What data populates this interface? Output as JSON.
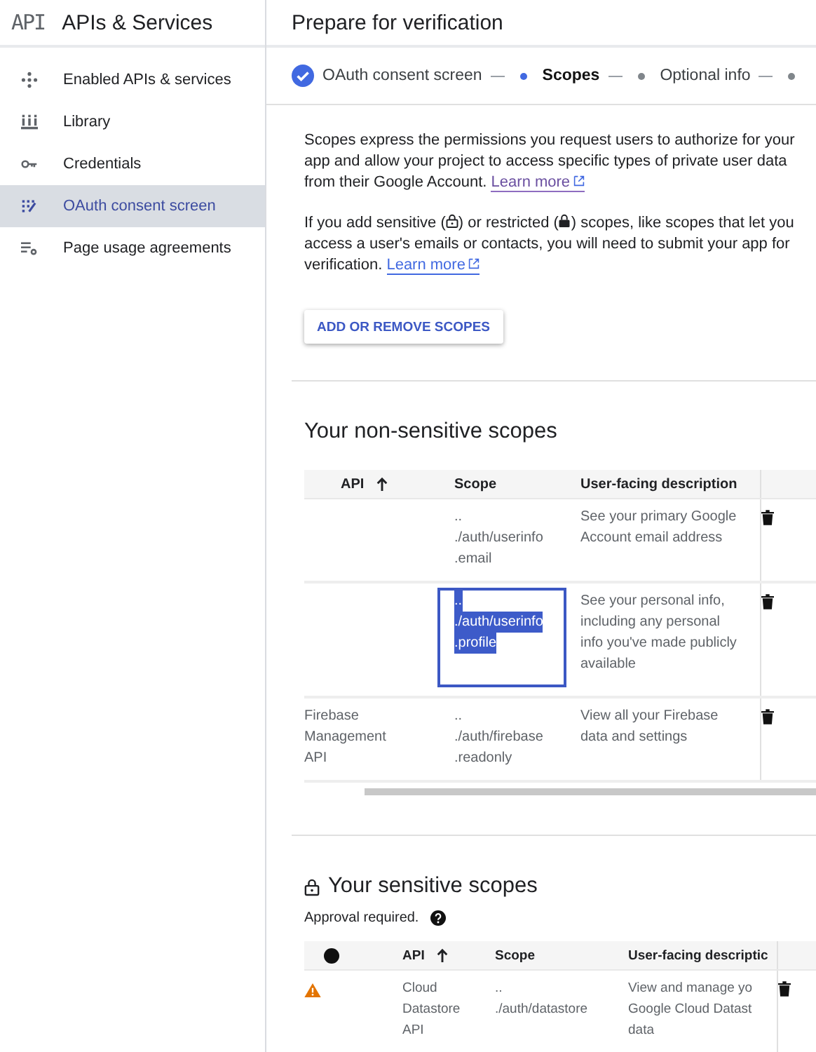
{
  "sidebar": {
    "logo": "API",
    "title": "APIs & Services",
    "items": [
      {
        "label": "Enabled APIs & services",
        "selected": false
      },
      {
        "label": "Library",
        "selected": false
      },
      {
        "label": "Credentials",
        "selected": false
      },
      {
        "label": "OAuth consent screen",
        "selected": true
      },
      {
        "label": "Page usage agreements",
        "selected": false
      }
    ]
  },
  "page_title": "Prepare for verification",
  "steps": [
    {
      "label": "OAuth consent screen",
      "done": true,
      "selected": false
    },
    {
      "label": "Scopes",
      "done": false,
      "selected": true
    },
    {
      "label": "Optional info",
      "done": false,
      "selected": false
    },
    {
      "done": false,
      "selected": false
    }
  ],
  "intro": {
    "text": "Scopes express the permissions you request users to authorize for your app and allow your project to access specific types of private user data from their Google Account.",
    "link": "Learn more"
  },
  "notice": {
    "before": "If you add sensitive (",
    "middle": ") or restricted (",
    "after": ") scopes, like scopes that let you access a user's emails or contacts, you will need to submit your app for verification.",
    "link": "Learn more"
  },
  "add_button": "ADD OR REMOVE SCOPES",
  "non_sensitive": {
    "title": "Your non-sensitive scopes",
    "columns": [
      "API",
      "Scope",
      "User-facing description"
    ],
    "rows": [
      {
        "api": [],
        "scope": [
          "..",
          "./auth/userinfo",
          ".email"
        ],
        "description": [
          "See your primary Google",
          "Account email address"
        ],
        "scope_selected": false
      },
      {
        "api": [],
        "scope": [
          "..",
          "./auth/userinfo",
          ".profile"
        ],
        "description": [
          "See your personal info,",
          "including any personal",
          "info you've made publicly",
          "available"
        ],
        "scope_selected": true
      },
      {
        "api": [
          "Firebase",
          "Management",
          "API"
        ],
        "scope": [
          "..",
          "./auth/firebase",
          ".readonly"
        ],
        "description": [
          "View all your Firebase",
          "data and settings"
        ],
        "scope_selected": false
      }
    ]
  },
  "sensitive": {
    "title": "Your sensitive scopes",
    "note": "Approval required.",
    "columns": [
      "API",
      "Scope",
      "User-facing descriptic"
    ],
    "rows": [
      {
        "warning": true,
        "api": [
          "Cloud",
          "Datastore",
          "API"
        ],
        "scope": [
          "..",
          "./auth/datastore"
        ],
        "description": [
          "View and manage yo",
          "Google Cloud Datast",
          "data"
        ]
      }
    ]
  }
}
